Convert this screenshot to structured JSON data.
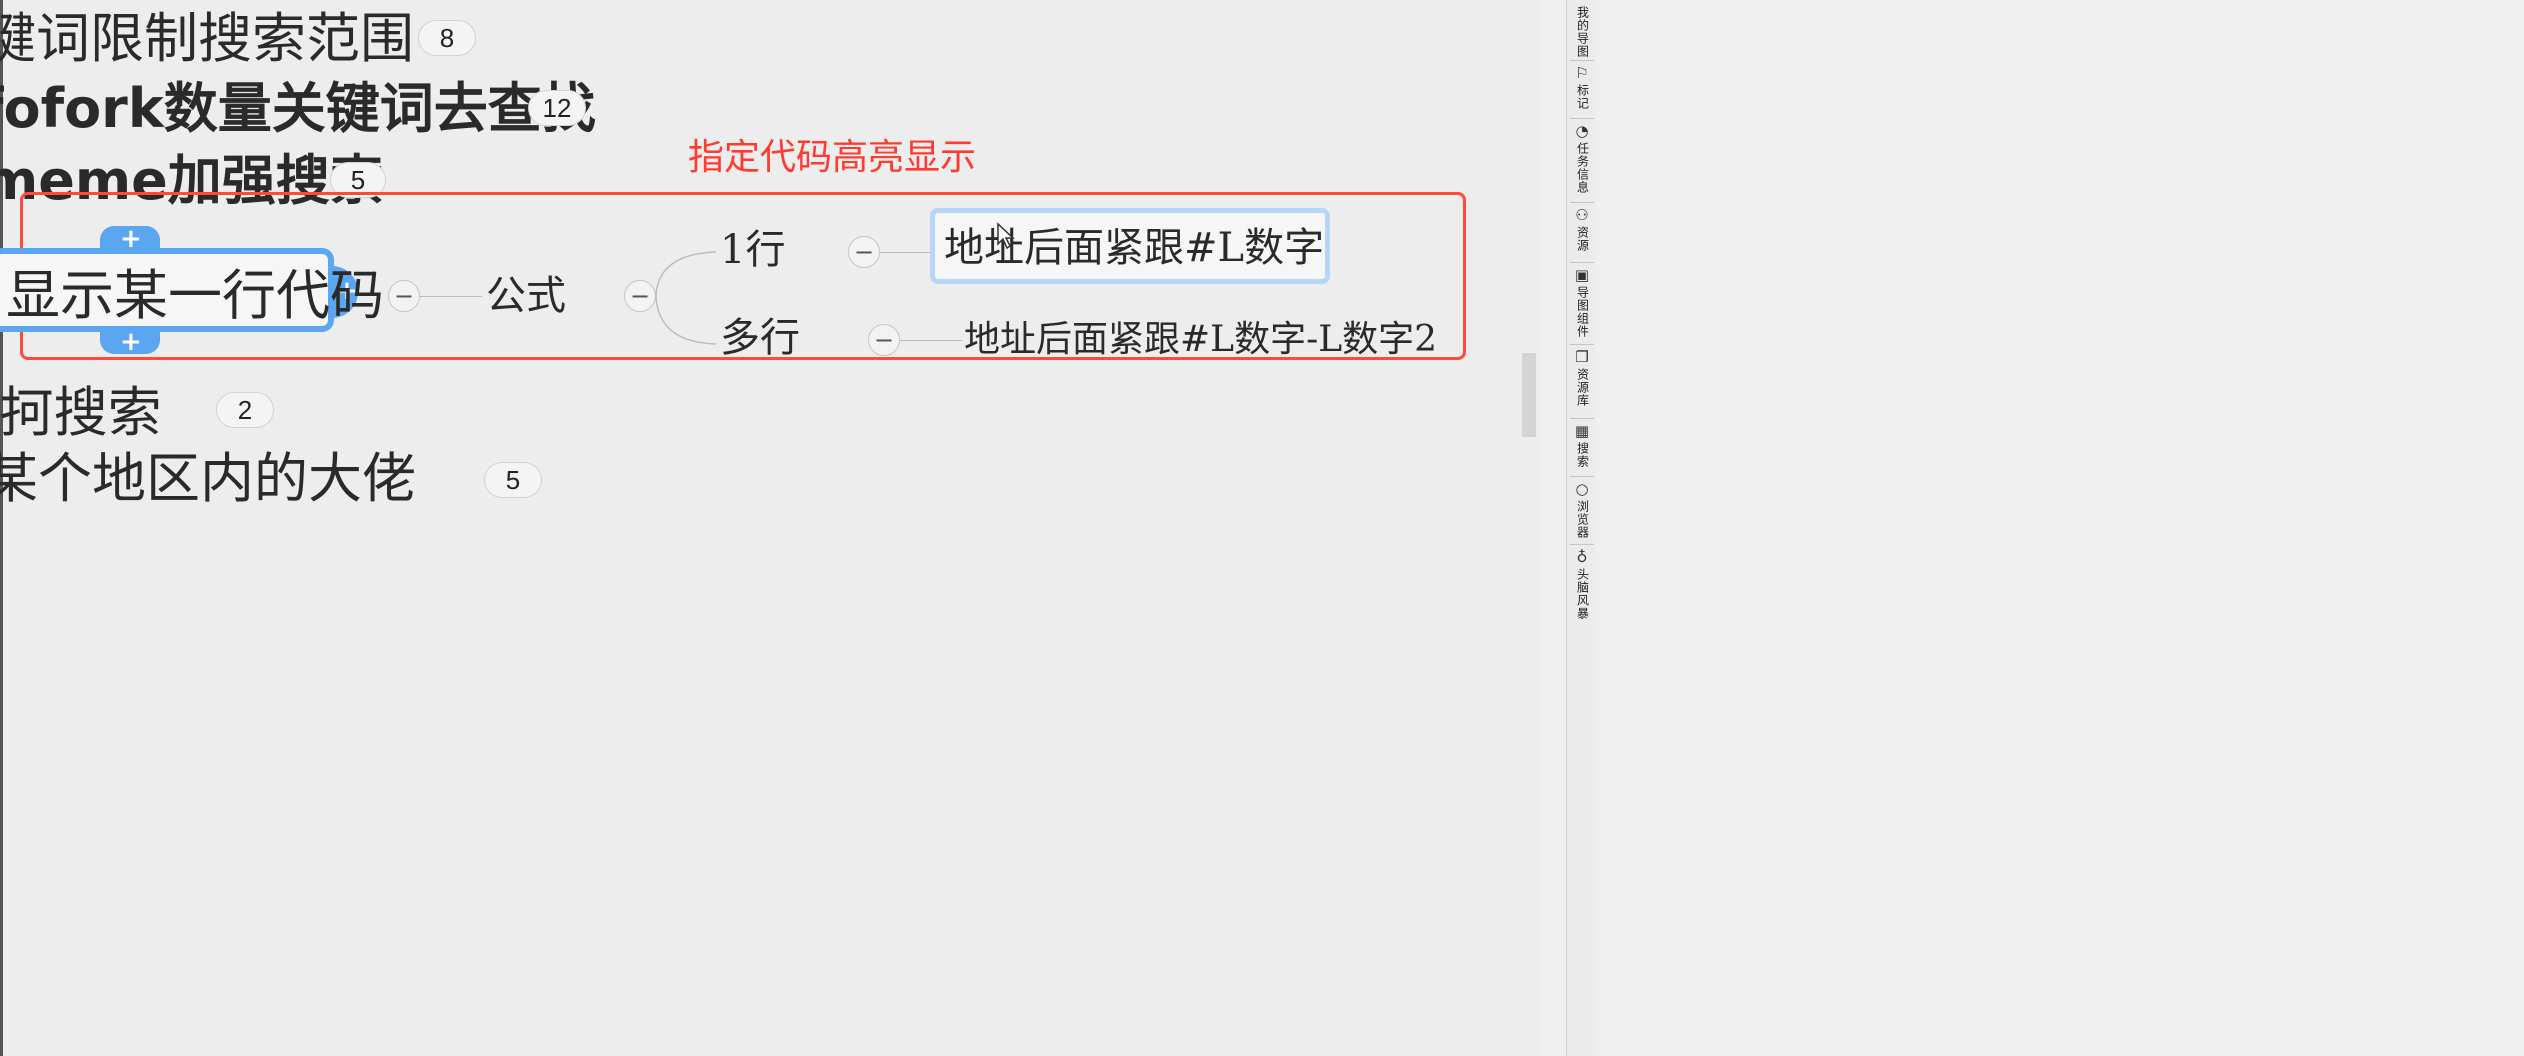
{
  "topics": [
    {
      "text": "键词限制搜索范围",
      "count": "8"
    },
    {
      "text": "fofork数量关键词去查找",
      "count": "12"
    },
    {
      "text": "meme加强搜索",
      "count": "5"
    },
    {
      "text": "ᵅ抲搜索",
      "count": "2"
    },
    {
      "text": "某个地区内的大佬",
      "count": "5"
    }
  ],
  "annotation": "指定代码高亮显示",
  "central_topic": "显示某一行代码",
  "formula_label": "公式",
  "branches": [
    {
      "label": "1行",
      "detail": "地址后面紧跟#L数字"
    },
    {
      "label": "多行",
      "detail": "地址后面紧跟#L数字-L数字2"
    }
  ],
  "collapse_symbol": "−",
  "sidebar": [
    {
      "label": "我的导图",
      "icon": "map-icon"
    },
    {
      "label": "标记",
      "icon": "marker-icon"
    },
    {
      "label": "任务信息",
      "icon": "task-icon"
    },
    {
      "label": "资源",
      "icon": "user-icon"
    },
    {
      "label": "导图组件",
      "icon": "component-icon"
    },
    {
      "label": "资源库",
      "icon": "library-icon"
    },
    {
      "label": "搜索",
      "icon": "search-icon"
    },
    {
      "label": "浏览器",
      "icon": "browser-icon"
    },
    {
      "label": "头脑风暴",
      "icon": "bulb-icon"
    }
  ],
  "colors": {
    "accent": "#5aa6f0",
    "annotation": "#ff3b2f",
    "selection": "#b6d6f5"
  }
}
